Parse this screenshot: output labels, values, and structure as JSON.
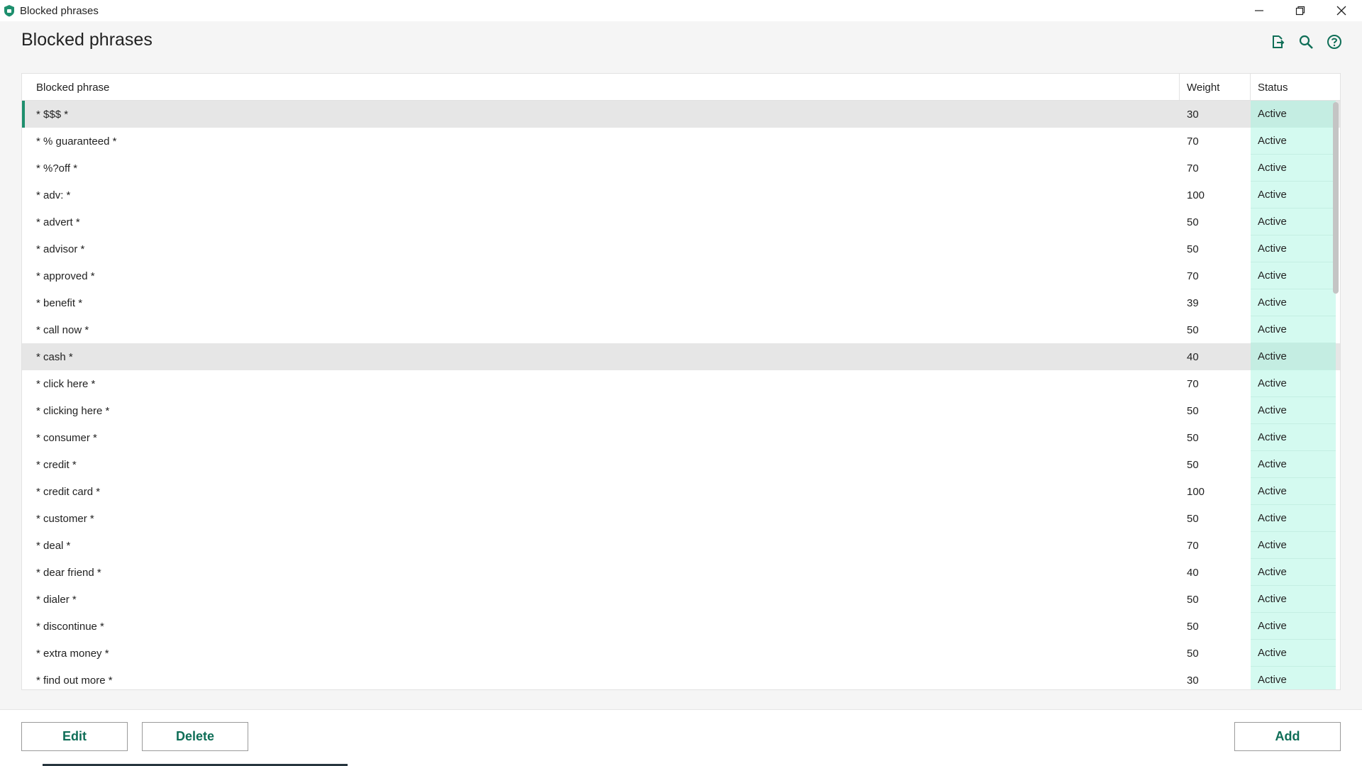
{
  "window": {
    "title": "Blocked phrases",
    "app_icon": "shield-icon",
    "controls": [
      "minimize-icon",
      "restore-icon",
      "close-icon"
    ]
  },
  "page": {
    "title": "Blocked phrases",
    "toolbar": [
      "export-icon",
      "search-icon",
      "help-icon"
    ]
  },
  "table": {
    "columns": {
      "phrase": "Blocked phrase",
      "weight": "Weight",
      "status": "Status"
    },
    "rows": [
      {
        "phrase": "* $$$ *",
        "weight": "30",
        "status": "Active"
      },
      {
        "phrase": "* % guaranteed *",
        "weight": "70",
        "status": "Active"
      },
      {
        "phrase": "* %?off *",
        "weight": "70",
        "status": "Active"
      },
      {
        "phrase": "* adv: *",
        "weight": "100",
        "status": "Active"
      },
      {
        "phrase": "* advert *",
        "weight": "50",
        "status": "Active"
      },
      {
        "phrase": "* advisor *",
        "weight": "50",
        "status": "Active"
      },
      {
        "phrase": "* approved *",
        "weight": "70",
        "status": "Active"
      },
      {
        "phrase": "* benefit *",
        "weight": "39",
        "status": "Active"
      },
      {
        "phrase": "* call now *",
        "weight": "50",
        "status": "Active"
      },
      {
        "phrase": "* cash *",
        "weight": "40",
        "status": "Active"
      },
      {
        "phrase": "* click here *",
        "weight": "70",
        "status": "Active"
      },
      {
        "phrase": "* clicking here *",
        "weight": "50",
        "status": "Active"
      },
      {
        "phrase": "* consumer *",
        "weight": "50",
        "status": "Active"
      },
      {
        "phrase": "* credit *",
        "weight": "50",
        "status": "Active"
      },
      {
        "phrase": "* credit card *",
        "weight": "100",
        "status": "Active"
      },
      {
        "phrase": "* customer *",
        "weight": "50",
        "status": "Active"
      },
      {
        "phrase": "* deal *",
        "weight": "70",
        "status": "Active"
      },
      {
        "phrase": "* dear friend *",
        "weight": "40",
        "status": "Active"
      },
      {
        "phrase": "* dialer *",
        "weight": "50",
        "status": "Active"
      },
      {
        "phrase": "* discontinue *",
        "weight": "50",
        "status": "Active"
      },
      {
        "phrase": "* extra money *",
        "weight": "50",
        "status": "Active"
      },
      {
        "phrase": "* find out more *",
        "weight": "30",
        "status": "Active"
      }
    ],
    "selected_row": 0,
    "hover_row": 9
  },
  "buttons": {
    "edit": "Edit",
    "delete": "Delete",
    "add": "Add"
  },
  "colors": {
    "accent": "#0f6e57",
    "selection_bar": "#1e8f6e",
    "status_bg": "#d4faf0"
  }
}
